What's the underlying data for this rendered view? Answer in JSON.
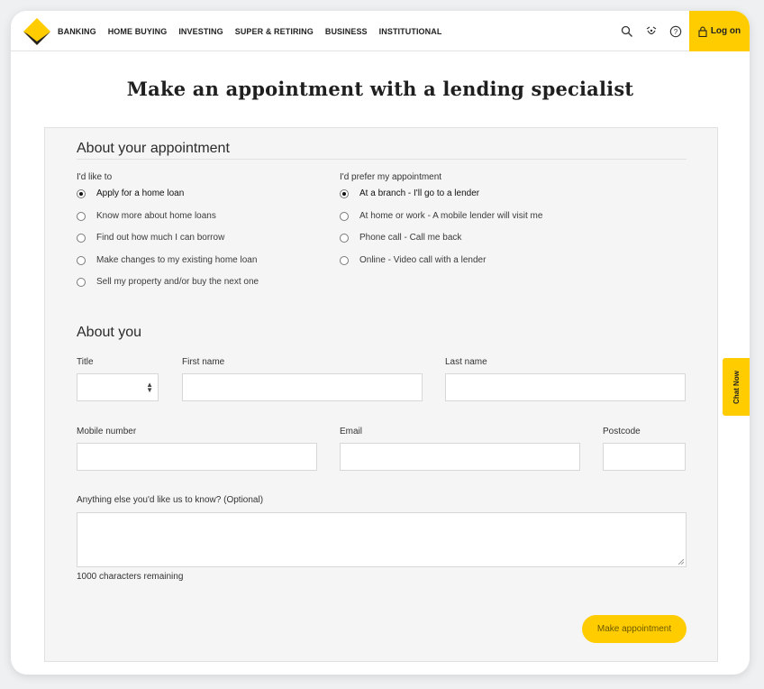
{
  "nav": {
    "links": [
      "BANKING",
      "HOME BUYING",
      "INVESTING",
      "SUPER & RETIRING",
      "BUSINESS",
      "INSTITUTIONAL"
    ],
    "icons": [
      "search-icon",
      "assistant-icon",
      "help-icon"
    ],
    "login_label": "Log on",
    "accent": "#ffcc00"
  },
  "page": {
    "title": "Make an appointment with a lending specialist"
  },
  "appointment": {
    "heading": "About your appointment",
    "purpose_label": "I'd like to",
    "purpose_options": [
      "Apply for a home loan",
      "Know more about home loans",
      "Find out how much I can borrow",
      "Make changes to my existing home loan",
      "Sell my property and/or buy the next one"
    ],
    "purpose_selected": "Apply for a home loan",
    "method_label": "I'd prefer my appointment",
    "method_options": [
      "At a branch - I'll go to a lender",
      "At home or work - A mobile lender will visit me",
      "Phone call - Call me back",
      "Online - Video call with a lender"
    ],
    "method_selected": "At a branch - I'll go to a lender"
  },
  "about_you": {
    "heading": "About you",
    "title_label": "Title",
    "title_value": "",
    "first_name_label": "First name",
    "first_name_value": "",
    "last_name_label": "Last name",
    "last_name_value": "",
    "mobile_label": "Mobile number",
    "mobile_value": "",
    "email_label": "Email",
    "email_value": "",
    "postcode_label": "Postcode",
    "postcode_value": "",
    "notes_label": "Anything else you'd like us to know? (Optional)",
    "notes_value": "",
    "counter_text": "1000 characters remaining",
    "submit_label": "Make appointment"
  },
  "chat": {
    "label": "Chat Now"
  }
}
